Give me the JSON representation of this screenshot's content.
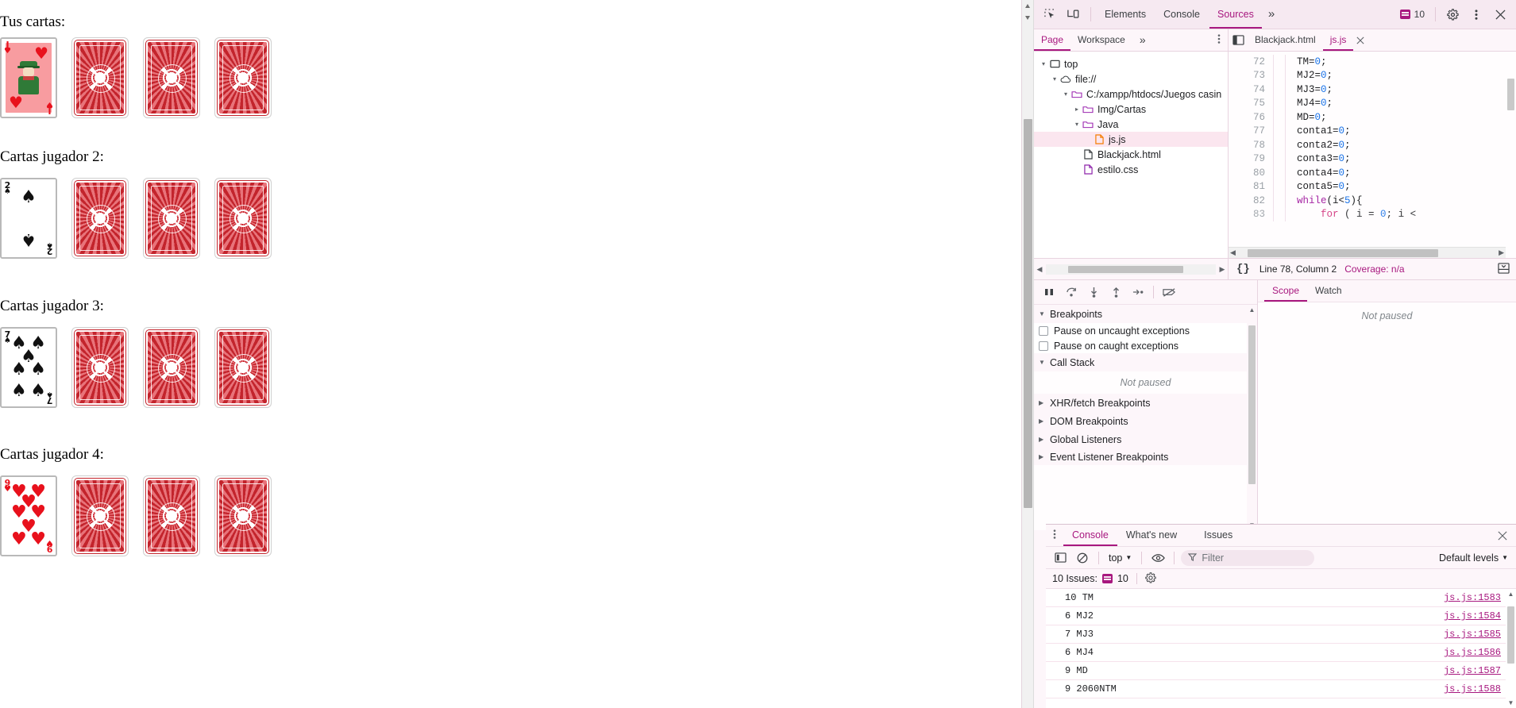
{
  "page": {
    "hands": [
      {
        "title": "Tus cartas:",
        "cards": [
          {
            "type": "face",
            "rank": "J",
            "suit": "hearts",
            "label": "jack-of-hearts"
          },
          {
            "type": "back",
            "label": "card-back"
          },
          {
            "type": "back",
            "label": "card-back"
          },
          {
            "type": "back",
            "label": "card-back"
          }
        ]
      },
      {
        "title": "Cartas jugador 2:",
        "cards": [
          {
            "type": "pip",
            "rank": "2",
            "suit": "spades",
            "label": "two-of-spades"
          },
          {
            "type": "back",
            "label": "card-back"
          },
          {
            "type": "back",
            "label": "card-back"
          },
          {
            "type": "back",
            "label": "card-back"
          }
        ]
      },
      {
        "title": "Cartas jugador 3:",
        "cards": [
          {
            "type": "pip",
            "rank": "7",
            "suit": "spades",
            "label": "seven-of-spades"
          },
          {
            "type": "back",
            "label": "card-back"
          },
          {
            "type": "back",
            "label": "card-back"
          },
          {
            "type": "back",
            "label": "card-back"
          }
        ]
      },
      {
        "title": "Cartas jugador 4:",
        "cards": [
          {
            "type": "pip",
            "rank": "9",
            "suit": "hearts",
            "label": "nine-of-hearts"
          },
          {
            "type": "back",
            "label": "card-back"
          },
          {
            "type": "back",
            "label": "card-back"
          },
          {
            "type": "back",
            "label": "card-back"
          }
        ]
      }
    ]
  },
  "devtools": {
    "toolbar": {
      "inspect_icon": "inspect-element-icon",
      "device_icon": "device-toolbar-icon",
      "tabs": [
        {
          "label": "Elements",
          "active": false
        },
        {
          "label": "Console",
          "active": false
        },
        {
          "label": "Sources",
          "active": true
        }
      ],
      "more_tabs": "»",
      "issues_count": "10",
      "settings_icon": "gear-icon",
      "kebab_icon": "more-options-icon",
      "close_icon": "close-icon"
    },
    "sources": {
      "nav_tabs": [
        {
          "label": "Page",
          "active": true
        },
        {
          "label": "Workspace",
          "active": false
        }
      ],
      "nav_more": "»",
      "nav_kebab": "⋮",
      "panel_toggle_icon": "show-navigator-icon",
      "open_files": [
        {
          "label": "Blackjack.html",
          "active": false
        },
        {
          "label": "js.js",
          "active": true
        }
      ],
      "file_close_icon": "close-icon",
      "tree": [
        {
          "indent": 0,
          "label": "top",
          "icon": "frame-icon",
          "twist": "▾",
          "selected": false
        },
        {
          "indent": 1,
          "label": "file://",
          "icon": "cloud-icon",
          "twist": "▾",
          "selected": false
        },
        {
          "indent": 2,
          "label": "C:/xampp/htdocs/Juegos casin",
          "icon": "folder-icon",
          "twist": "▾",
          "selected": false
        },
        {
          "indent": 3,
          "label": "Img/Cartas",
          "icon": "folder-icon",
          "twist": "▸",
          "selected": false
        },
        {
          "indent": 3,
          "label": "Java",
          "icon": "folder-icon",
          "twist": "▾",
          "selected": false
        },
        {
          "indent": 4,
          "label": "js.js",
          "icon": "js-file-icon",
          "twist": "",
          "selected": true
        },
        {
          "indent": 3,
          "label": "Blackjack.html",
          "icon": "html-file-icon",
          "twist": "",
          "selected": false
        },
        {
          "indent": 3,
          "label": "estilo.css",
          "icon": "css-file-icon",
          "twist": "",
          "selected": false
        }
      ],
      "code": [
        {
          "num": "72",
          "text": "    TM=0;"
        },
        {
          "num": "73",
          "text": "    MJ2=0;"
        },
        {
          "num": "74",
          "text": "    MJ3=0;"
        },
        {
          "num": "75",
          "text": "    MJ4=0;"
        },
        {
          "num": "76",
          "text": "    MD=0;"
        },
        {
          "num": "77",
          "text": "    conta1=0;"
        },
        {
          "num": "78",
          "text": "    conta2=0;"
        },
        {
          "num": "79",
          "text": "    conta3=0;"
        },
        {
          "num": "80",
          "text": "    conta4=0;"
        },
        {
          "num": "81",
          "text": "    conta5=0;"
        },
        {
          "num": "82",
          "text": "    while(i<5){"
        },
        {
          "num": "83",
          "text": "        for ( i = 0; i <"
        }
      ],
      "status": {
        "format_icon": "pretty-print-icon",
        "position": "Line 78, Column 2",
        "coverage": "Coverage: n/a",
        "drawer_icon": "show-drawer-icon"
      }
    },
    "debugger": {
      "controls": [
        {
          "icon": "pause-resume-icon",
          "name": "pause-script-button"
        },
        {
          "icon": "step-over-icon",
          "name": "step-over-button"
        },
        {
          "icon": "step-into-icon",
          "name": "step-into-button"
        },
        {
          "icon": "step-out-icon",
          "name": "step-out-button"
        },
        {
          "icon": "step-icon",
          "name": "step-button"
        },
        {
          "icon": "deactivate-breakpoints-icon",
          "name": "deactivate-breakpoints-button"
        }
      ],
      "sections": [
        {
          "label": "Breakpoints",
          "expanded": true
        },
        {
          "label": "Call Stack",
          "expanded": true
        },
        {
          "label": "XHR/fetch Breakpoints",
          "expanded": false
        },
        {
          "label": "DOM Breakpoints",
          "expanded": false
        },
        {
          "label": "Global Listeners",
          "expanded": false
        },
        {
          "label": "Event Listener Breakpoints",
          "expanded": false
        }
      ],
      "checkboxes": [
        {
          "label": "Pause on uncaught exceptions",
          "checked": false
        },
        {
          "label": "Pause on caught exceptions",
          "checked": false
        }
      ],
      "call_stack_empty": "Not paused",
      "scope_tabs": [
        {
          "label": "Scope",
          "active": true
        },
        {
          "label": "Watch",
          "active": false
        }
      ],
      "scope_empty": "Not paused"
    },
    "drawer": {
      "kebab_icon": "more-tools-icon",
      "tabs": [
        {
          "label": "Console",
          "active": true
        },
        {
          "label": "What's new",
          "active": false
        },
        {
          "label": "Issues",
          "active": false
        }
      ],
      "close_icon": "close-icon",
      "sidebar_icon": "console-sidebar-icon",
      "clear_icon": "clear-console-icon",
      "context": "top",
      "eye_icon": "live-expression-icon",
      "filter_icon": "filter-icon",
      "filter_placeholder": "Filter",
      "filter_value": "",
      "levels": "Default levels",
      "issues_summary": "10 Issues:",
      "issues_badge": "10",
      "issues_gear_icon": "gear-icon",
      "messages": [
        {
          "text": "10  TM",
          "source": "js.js:1583"
        },
        {
          "text": "6  MJ2",
          "source": "js.js:1584"
        },
        {
          "text": "7  MJ3",
          "source": "js.js:1585"
        },
        {
          "text": "6  MJ4",
          "source": "js.js:1586"
        },
        {
          "text": "9  MD",
          "source": "js.js:1587"
        },
        {
          "text": "9  2060NTM",
          "source": "js.js:1588"
        }
      ]
    },
    "colors": {
      "accent": "#a8187f",
      "toolbar_bg": "#f6e9f1",
      "panel_bg": "#fdf6fa",
      "selected_row": "#fbe6ef"
    }
  }
}
